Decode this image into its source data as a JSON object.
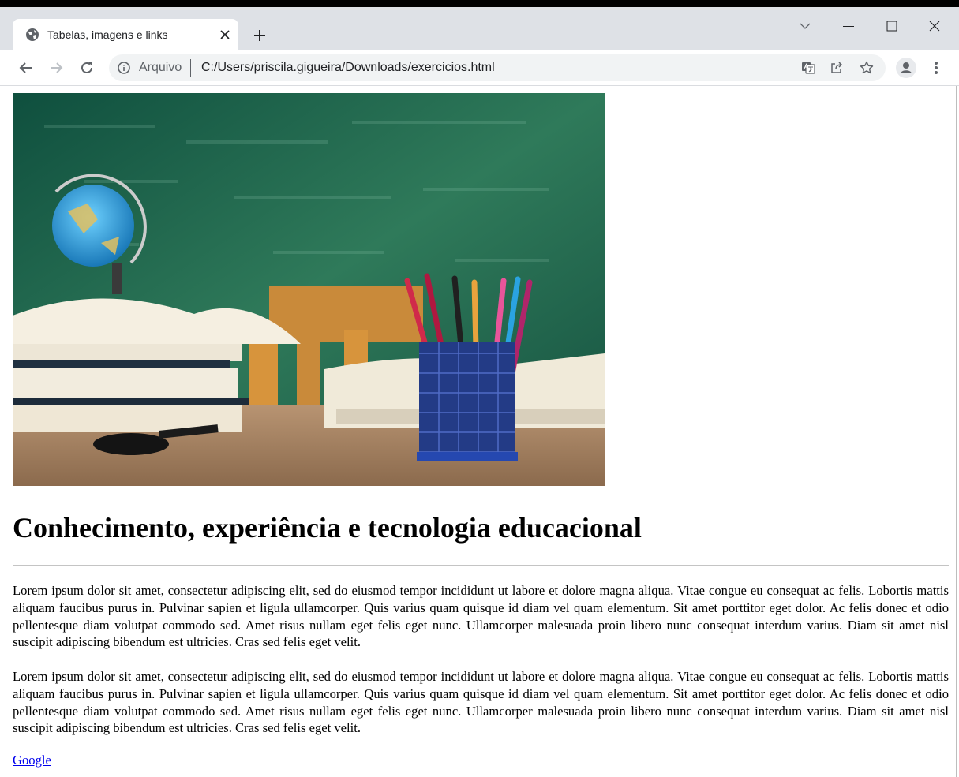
{
  "browser": {
    "tab": {
      "title": "Tabelas, imagens e links"
    },
    "address_bar": {
      "scheme_label": "Arquivo",
      "url": "C:/Users/priscila.gigueira/Downloads/exercicios.html"
    }
  },
  "page": {
    "heading": "Conhecimento, experiência e tecnologia educacional",
    "paragraphs": [
      "Lorem ipsum dolor sit amet, consectetur adipiscing elit, sed do eiusmod tempor incididunt ut labore et dolore magna aliqua. Vitae congue eu consequat ac felis. Lobortis mattis aliquam faucibus purus in. Pulvinar sapien et ligula ullamcorper. Quis varius quam quisque id diam vel quam elementum. Sit amet porttitor eget dolor. Ac felis donec et odio pellentesque diam volutpat commodo sed. Amet risus nullam eget felis eget nunc. Ullamcorper malesuada proin libero nunc consequat interdum varius. Diam sit amet nisl suscipit adipiscing bibendum est ultricies. Cras sed felis eget velit.",
      "Lorem ipsum dolor sit amet, consectetur adipiscing elit, sed do eiusmod tempor incididunt ut labore et dolore magna aliqua. Vitae congue eu consequat ac felis. Lobortis mattis aliquam faucibus purus in. Pulvinar sapien et ligula ullamcorper. Quis varius quam quisque id diam vel quam elementum. Sit amet porttitor eget dolor. Ac felis donec et odio pellentesque diam volutpat commodo sed. Amet risus nullam eget felis eget nunc. Ullamcorper malesuada proin libero nunc consequat interdum varius. Diam sit amet nisl suscipit adipiscing bibendum est ultricies. Cras sed felis eget velit."
    ],
    "link_text": "Google"
  },
  "colors": {
    "tabbar_bg": "#dee1e6",
    "omnibox_bg": "#f1f3f4",
    "link": "#0000ee",
    "chalkboard": "#2f7a5a"
  }
}
